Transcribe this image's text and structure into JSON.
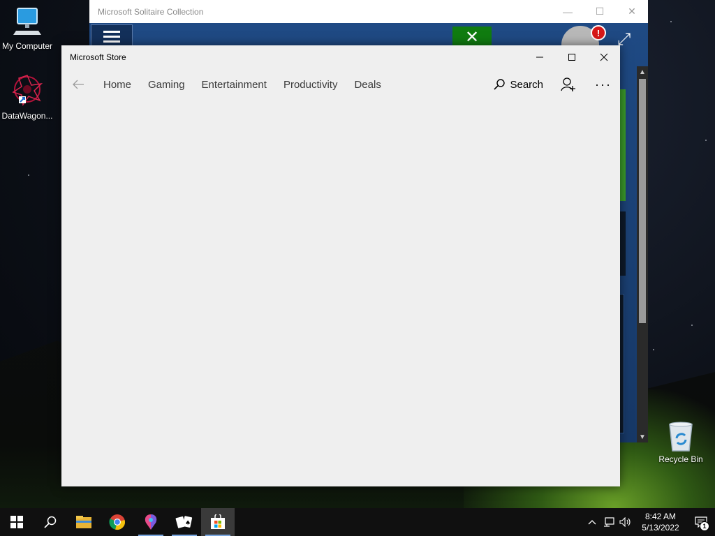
{
  "desktop": {
    "icons": [
      {
        "label": "My Computer",
        "icon": "computer-icon"
      },
      {
        "label": "DataWagon...",
        "icon": "datawagon-icon"
      }
    ],
    "recycle_bin": {
      "label": "Recycle Bin",
      "icon": "recycle-bin-icon"
    }
  },
  "solitaire_window": {
    "title": "Microsoft Solitaire Collection",
    "alert_badge": "!",
    "controls": [
      "—",
      "☐",
      "✕"
    ]
  },
  "store_window": {
    "title": "Microsoft Store",
    "nav_tabs": [
      "Home",
      "Gaming",
      "Entertainment",
      "Productivity",
      "Deals"
    ],
    "search_label": "Search",
    "more_label": "···"
  },
  "taskbar": {
    "pinned": [
      "start-icon",
      "search-icon",
      "file-explorer-icon",
      "chrome-icon",
      "paint-3d-icon",
      "solitaire-icon",
      "store-icon"
    ],
    "clock_time": "8:42 AM",
    "clock_date": "5/13/2022",
    "notification_count": "1"
  },
  "colors": {
    "store_bg": "#efefef",
    "taskbar_bg": "#101010",
    "solitaire_bg": "#1b3a6b",
    "xbox_green": "#107c10",
    "alert_red": "#d71818"
  }
}
